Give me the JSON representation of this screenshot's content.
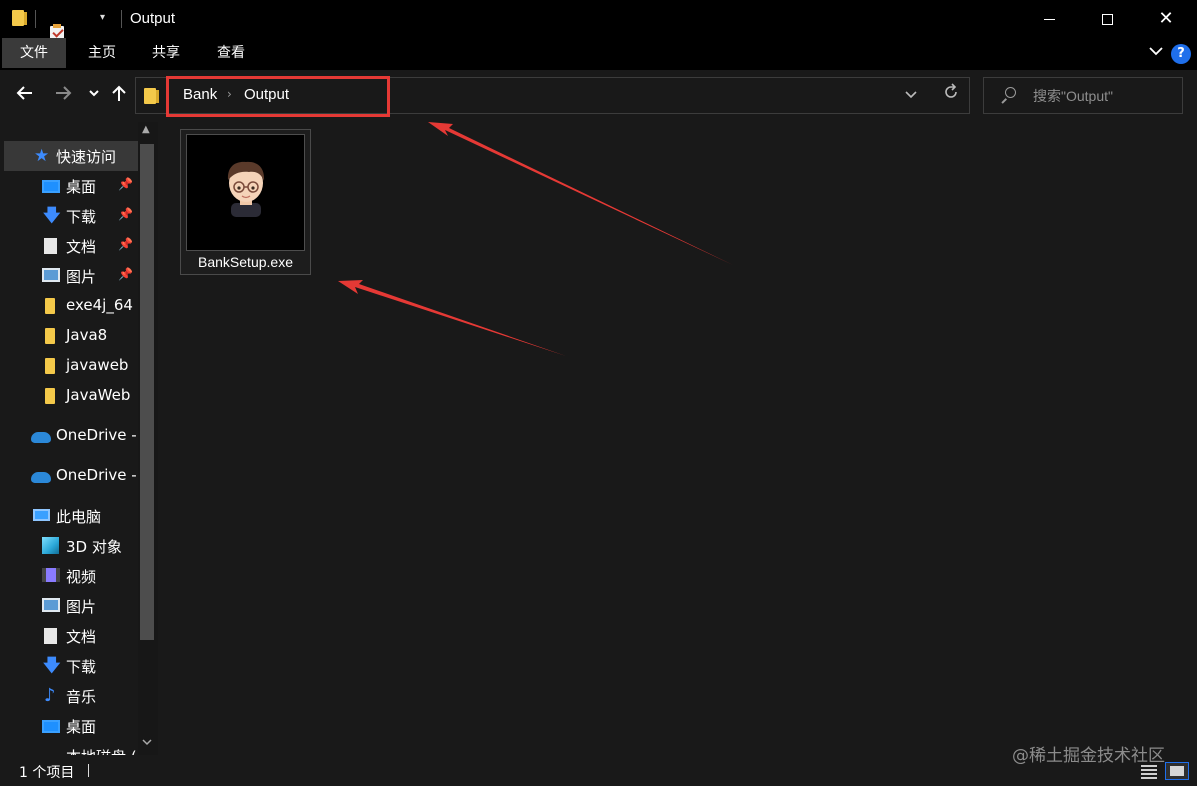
{
  "window": {
    "title": "Output",
    "controls": {
      "minimize": "minimize",
      "maximize": "maximize",
      "close": "✕"
    }
  },
  "ribbon": {
    "tabs": [
      "文件",
      "主页",
      "共享",
      "查看"
    ],
    "help": "?"
  },
  "nav": {
    "back": "←",
    "forward": "→",
    "recent": "⌄",
    "up": "↑",
    "breadcrumb": [
      "Bank",
      "Output"
    ],
    "search_placeholder": "搜索\"Output\""
  },
  "sidebar": {
    "items": [
      {
        "label": "快速访问",
        "icon": "star-icon",
        "pinned": false
      },
      {
        "label": "桌面",
        "icon": "desktop-icon",
        "pinned": true
      },
      {
        "label": "下载",
        "icon": "download-icon",
        "pinned": true
      },
      {
        "label": "文档",
        "icon": "document-icon",
        "pinned": true
      },
      {
        "label": "图片",
        "icon": "pictures-icon",
        "pinned": true
      },
      {
        "label": "exe4j_64",
        "icon": "folder-icon",
        "pinned": false
      },
      {
        "label": "Java8",
        "icon": "folder-icon",
        "pinned": false
      },
      {
        "label": "javaweb",
        "icon": "folder-icon",
        "pinned": false
      },
      {
        "label": "JavaWeb",
        "icon": "folder-icon",
        "pinned": false
      },
      {
        "label": "OneDrive -",
        "icon": "onedrive-icon",
        "pinned": false
      },
      {
        "label": "OneDrive -",
        "icon": "onedrive-icon",
        "pinned": false
      },
      {
        "label": "此电脑",
        "icon": "this-pc-icon",
        "pinned": false
      },
      {
        "label": "3D 对象",
        "icon": "3d-objects-icon",
        "pinned": false
      },
      {
        "label": "视频",
        "icon": "videos-icon",
        "pinned": false
      },
      {
        "label": "图片",
        "icon": "pictures-icon",
        "pinned": false
      },
      {
        "label": "文档",
        "icon": "document-icon",
        "pinned": false
      },
      {
        "label": "下载",
        "icon": "download-icon",
        "pinned": false
      },
      {
        "label": "音乐",
        "icon": "music-icon",
        "pinned": false
      },
      {
        "label": "桌面",
        "icon": "desktop-icon",
        "pinned": false
      },
      {
        "label": "本地磁盘 (",
        "icon": "local-disk-icon",
        "pinned": false
      }
    ]
  },
  "content": {
    "files": [
      {
        "name": "BankSetup.exe",
        "icon": "avatar-app-icon"
      }
    ]
  },
  "status": {
    "item_count": "1 个项目"
  },
  "watermark": "@稀土掘金技术社区",
  "colors": {
    "background": "#191919",
    "titlebar": "#000000",
    "annotation": "#e53935",
    "accent": "#1f6feb"
  }
}
